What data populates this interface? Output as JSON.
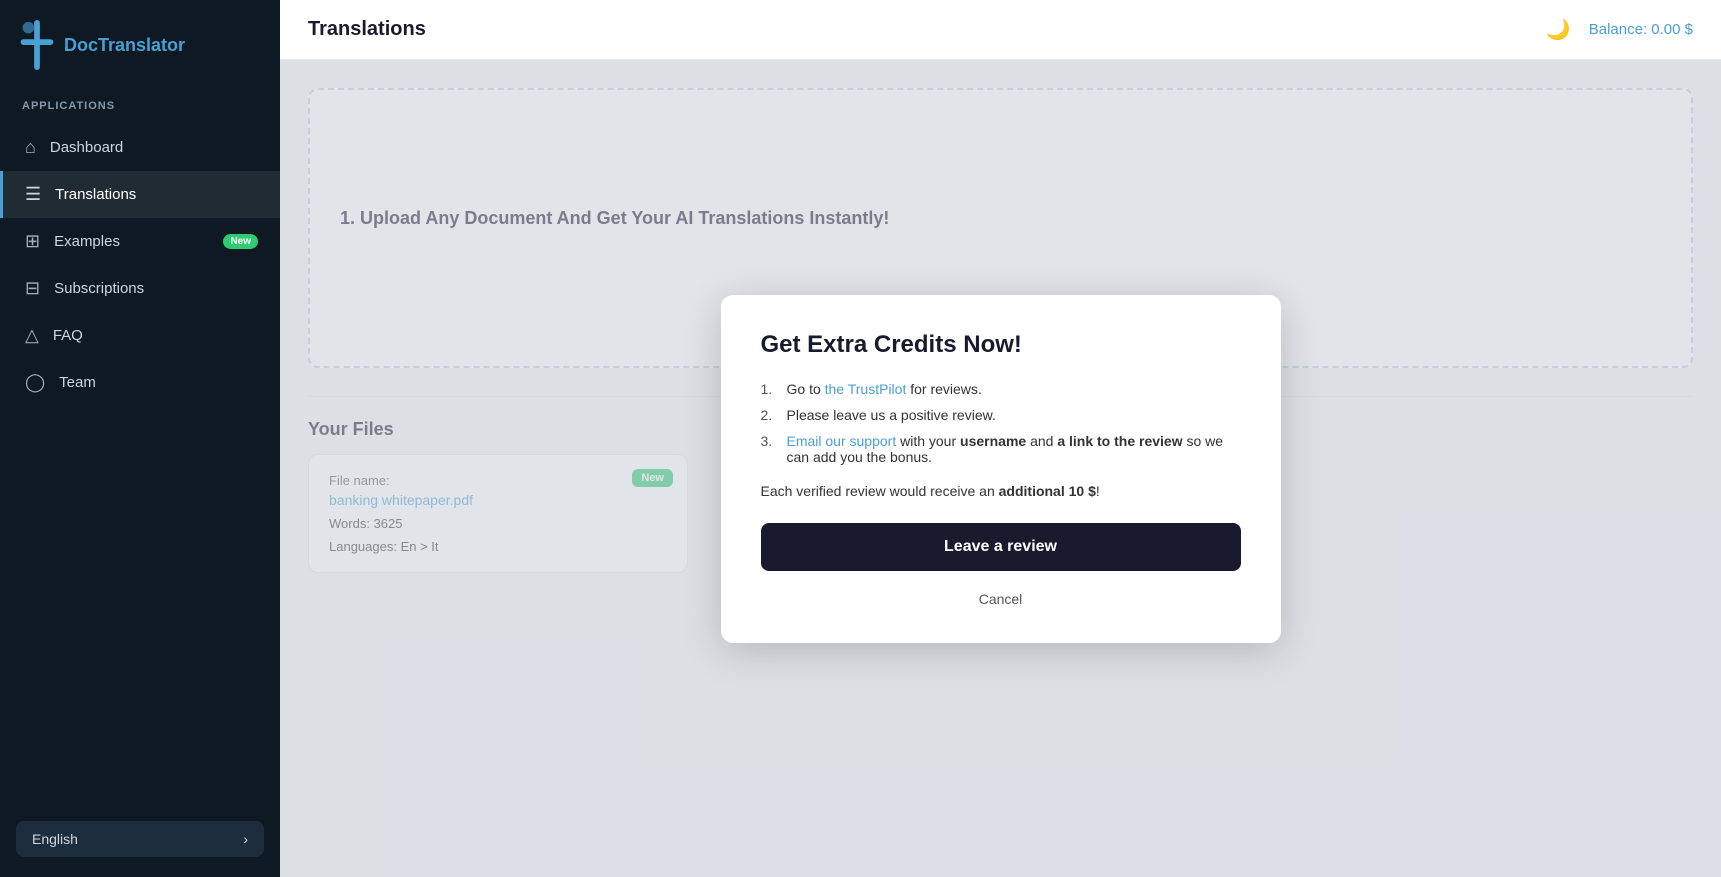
{
  "sidebar": {
    "logo_text": "DocTranslator",
    "section_label": "APPLICATIONS",
    "nav_items": [
      {
        "id": "dashboard",
        "label": "Dashboard",
        "icon": "⌂",
        "active": false,
        "badge": null
      },
      {
        "id": "translations",
        "label": "Translations",
        "icon": "☰",
        "active": true,
        "badge": null
      },
      {
        "id": "examples",
        "label": "Examples",
        "icon": "☷",
        "active": false,
        "badge": "New"
      },
      {
        "id": "subscriptions",
        "label": "Subscriptions",
        "icon": "◫",
        "active": false,
        "badge": null
      },
      {
        "id": "faq",
        "label": "FAQ",
        "icon": "△",
        "active": false,
        "badge": null
      },
      {
        "id": "team",
        "label": "Team",
        "icon": "◯",
        "active": false,
        "badge": null
      }
    ],
    "language": "English"
  },
  "topbar": {
    "title": "Translations",
    "balance_label": "Balance:",
    "balance_value": "0.00 $"
  },
  "upload_section": {
    "title": "1. Upload Any Document And Get Your AI Translations Instantly!",
    "hint_text": "horizontal"
  },
  "your_files": {
    "title": "Your Files",
    "file": {
      "name_label": "File name:",
      "name_value": "banking whitepaper.pdf",
      "words_label": "Words:",
      "words_value": "3625",
      "languages_label": "Languages:",
      "languages_value": "En > It",
      "badge": "New"
    }
  },
  "modal": {
    "title": "Get Extra Credits Now!",
    "steps": [
      {
        "num": "1.",
        "text_before": "Go to ",
        "link_text": "the TrustPilot",
        "link_href": "#",
        "text_after": " for reviews."
      },
      {
        "num": "2.",
        "text_plain": "Please leave us a positive review."
      },
      {
        "num": "3.",
        "text_before": "",
        "link_text": "Email our support",
        "text_middle": " with your ",
        "bold1": "username",
        "text_middle2": " and ",
        "bold2": "a link to the review",
        "text_after": " so we can add you the bonus."
      }
    ],
    "bonus_text_before": "Each verified review would receive an ",
    "bonus_amount": "additional 10 $",
    "bonus_text_after": "!",
    "leave_review_label": "Leave a review",
    "cancel_label": "Cancel"
  }
}
